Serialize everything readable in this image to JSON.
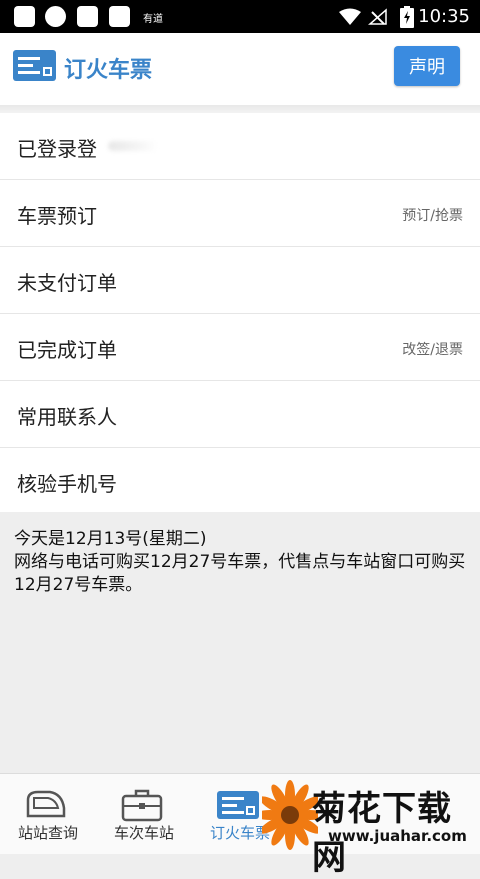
{
  "status_bar": {
    "app_label": "有道",
    "time": "10:35"
  },
  "header": {
    "title": "订火车票",
    "declare_button": "声明",
    "accent_color": "#3a84c9",
    "button_color": "#3a8be0"
  },
  "menu": {
    "items": [
      {
        "label": "已登录登",
        "hint": ""
      },
      {
        "label": "车票预订",
        "hint": "预订/抢票"
      },
      {
        "label": "未支付订单",
        "hint": ""
      },
      {
        "label": "已完成订单",
        "hint": "改签/退票"
      },
      {
        "label": "常用联系人",
        "hint": ""
      },
      {
        "label": "核验手机号",
        "hint": ""
      }
    ]
  },
  "info": {
    "line1": "今天是12月13号(星期二)",
    "line2": "网络与电话可购买12月27号车票，代售点与车站窗口可购买12月27号车票。"
  },
  "bottom_nav": {
    "items": [
      {
        "label": "站站查询",
        "icon": "train-icon"
      },
      {
        "label": "车次车站",
        "icon": "briefcase-icon"
      },
      {
        "label": "订火车票",
        "icon": "ticket-icon",
        "active": true
      }
    ]
  },
  "watermark": {
    "title": "菊花下载网",
    "url": "www.juahar.com"
  }
}
